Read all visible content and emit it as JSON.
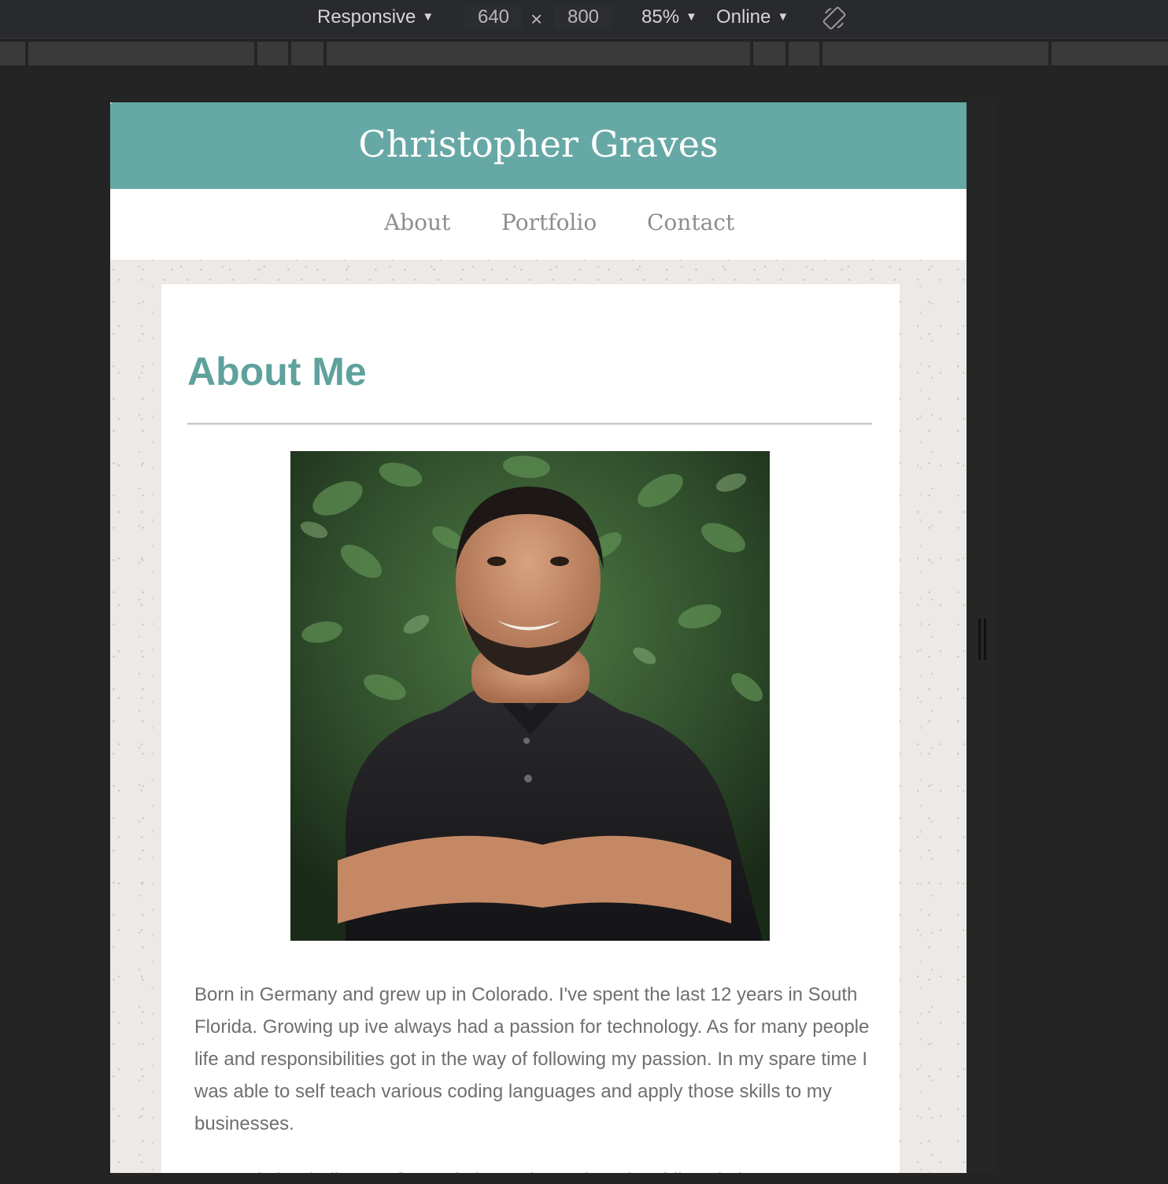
{
  "devtools": {
    "device_label": "Responsive",
    "width_value": "640",
    "times_sign": "×",
    "height_value": "800",
    "zoom_label": "85%",
    "network_label": "Online",
    "rotate_icon": "rotate-device-icon",
    "caret_icon": "▼"
  },
  "site": {
    "title": "Christopher Graves",
    "nav": {
      "about": "About",
      "portfolio": "Portfolio",
      "contact": "Contact"
    }
  },
  "about": {
    "heading": "About Me",
    "photo": "portrait-photo",
    "bio": "Born in Germany and grew up in Colorado. I've spent the last 12 years in South Florida. Growing up ive always had a passion for technology. As for many people life and responsibilities got in the way of following my passion. In my spare time I was able to self teach various coding languages and apply those skills to my businesses.",
    "bio_next": "Currently i've built out a few websites using web and mobile solutions"
  },
  "colors": {
    "header_bg": "#66a8a5",
    "heading": "#5fa19d",
    "nav_text": "#8e8e8e",
    "body_text": "#6f6f6f",
    "devtools_bg": "#292a2d"
  }
}
